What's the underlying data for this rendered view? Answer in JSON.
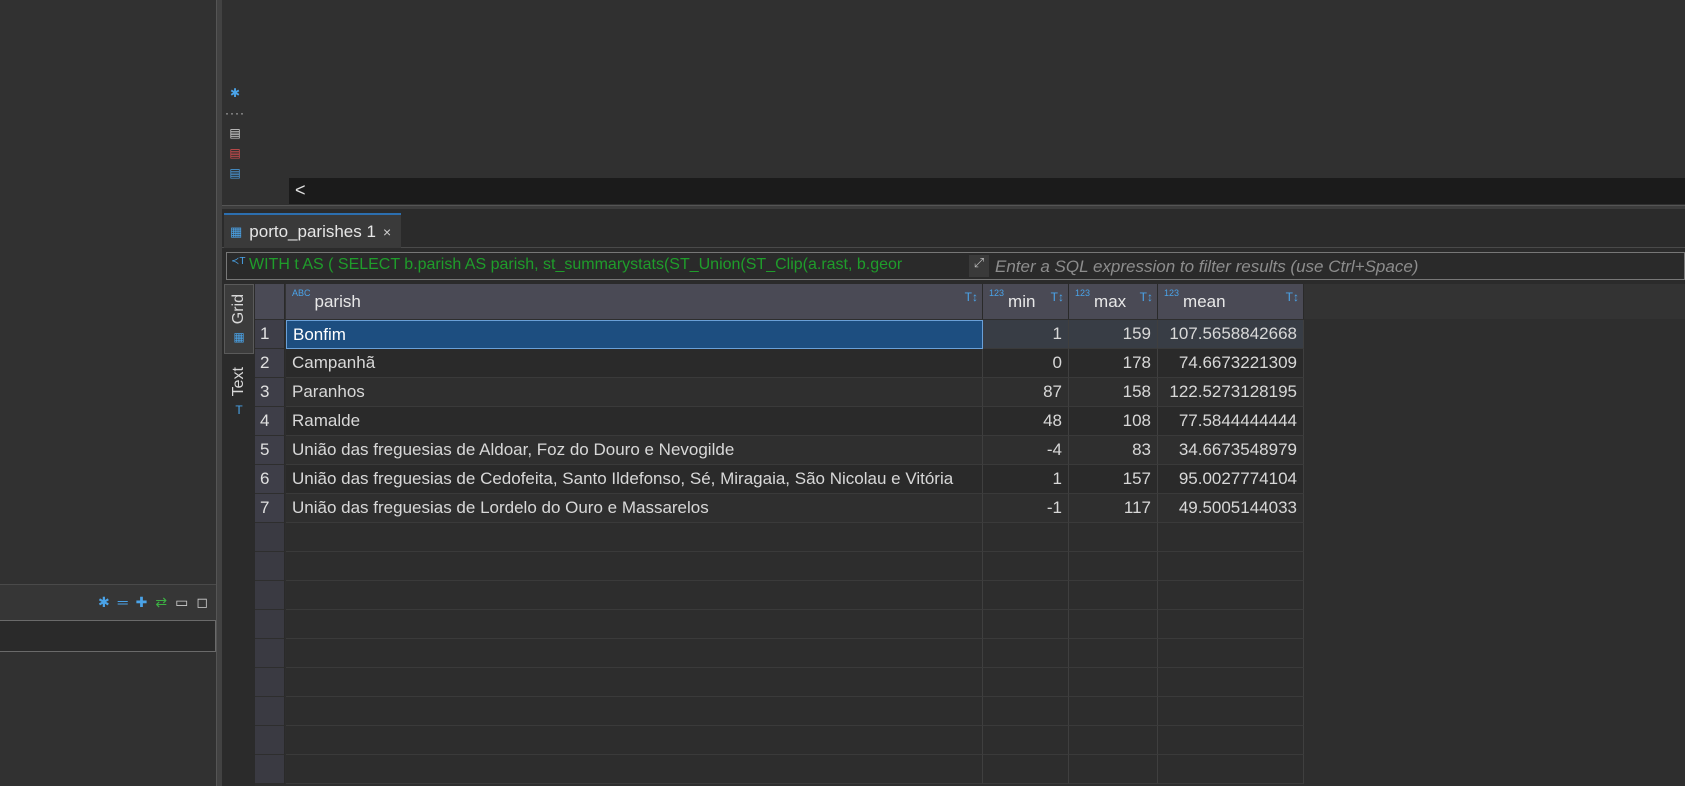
{
  "editor": {
    "scroll_left": "<"
  },
  "results": {
    "tab_label": "porto_parishes 1",
    "tab_close": "×"
  },
  "filter": {
    "query": "WITH t AS ( SELECT b.parish AS parish, st_summarystats(ST_Union(ST_Clip(a.rast, b.geor",
    "placeholder": "Enter a SQL expression to filter results (use Ctrl+Space)"
  },
  "side_tabs": {
    "grid": "Grid",
    "text": "Text"
  },
  "table": {
    "columns": [
      {
        "name": "parish",
        "type_badge": "ABC"
      },
      {
        "name": "min",
        "type_badge": "123"
      },
      {
        "name": "max",
        "type_badge": "123"
      },
      {
        "name": "mean",
        "type_badge": "123"
      }
    ],
    "rows": [
      {
        "num": "1",
        "parish": "Bonfim",
        "min": "1",
        "max": "159",
        "mean": "107.5658842668"
      },
      {
        "num": "2",
        "parish": "Campanhã",
        "min": "0",
        "max": "178",
        "mean": "74.6673221309"
      },
      {
        "num": "3",
        "parish": "Paranhos",
        "min": "87",
        "max": "158",
        "mean": "122.5273128195"
      },
      {
        "num": "4",
        "parish": "Ramalde",
        "min": "48",
        "max": "108",
        "mean": "77.5844444444"
      },
      {
        "num": "5",
        "parish": "União das freguesias de Aldoar, Foz do Douro e Nevogilde",
        "min": "-4",
        "max": "83",
        "mean": "34.6673548979"
      },
      {
        "num": "6",
        "parish": "União das freguesias de Cedofeita, Santo Ildefonso, Sé, Miragaia, São Nicolau e Vitória",
        "min": "1",
        "max": "157",
        "mean": "95.0027774104"
      },
      {
        "num": "7",
        "parish": "União das freguesias de Lordelo do Ouro e Massarelos",
        "min": "-1",
        "max": "117",
        "mean": "49.5005144033"
      }
    ]
  },
  "colors": {
    "accent": "#4aa3e8",
    "selected_cell": "#1d4e80",
    "query_text": "#1f9d2b"
  }
}
